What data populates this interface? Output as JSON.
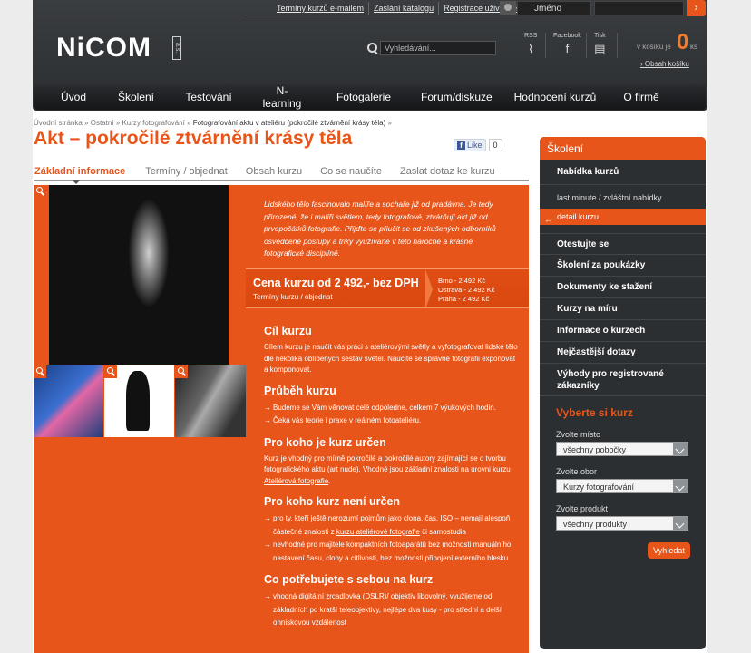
{
  "header": {
    "top_links": [
      "Termíny kurzů e-mailem",
      "Zaslání katalogu",
      "Registrace uživatele"
    ],
    "login_placeholder": "Jméno",
    "login_go": "›",
    "logo": "NiCOM",
    "logo_suffix": "a.s.",
    "search_placeholder": "Vyhledávání...",
    "social": [
      {
        "label": "RSS",
        "glyph": "⌇"
      },
      {
        "label": "Facebook",
        "glyph": "f"
      },
      {
        "label": "Tisk",
        "glyph": "▤"
      }
    ],
    "cart_label": "v košíku je",
    "cart_count": "0",
    "cart_unit": "ks",
    "cart_link": "Obsah košíku"
  },
  "nav": [
    "Úvod",
    "Školení",
    "Testování",
    "N-learning",
    "Fotogalerie",
    "Forum/diskuze",
    "Hodnocení kurzů",
    "O firmě"
  ],
  "breadcrumb": {
    "items": [
      "Úvodní stránka",
      "Ostatní",
      "Kurzy fotografování"
    ],
    "current": "Fotografování aktu v ateliéru (pokročilé ztvárnění krásy těla)"
  },
  "page_title": "Akt – pokročilé ztvárnění krásy těla",
  "fb": {
    "like": "Like",
    "count": "0"
  },
  "tabs": [
    "Základní informace",
    "Termíny / objednat",
    "Obsah kurzu",
    "Co se naučíte",
    "Zaslat dotaz ke kurzu"
  ],
  "intro": "Lidského tělo fascinovalo malíře a sochaře již od pradávna. Je tedy přirozené, že i malíři světlem, tedy fotografové, ztvárňují akt již od prvopočátků fotografie. Přijďte se přiučit se od zkušených odborníků osvědčené postupy a triky využívané v této náročné a krásné fotografické disciplíně.",
  "price": {
    "title": "Cena kurzu od 2 492,- bez DPH",
    "subtitle": "Termíny kurzu / objednat",
    "cities": [
      "Brno - 2 492 Kč",
      "Ostrava - 2 492 Kč",
      "Praha - 2 492 Kč"
    ]
  },
  "sections": {
    "cil_title": "Cíl kurzu",
    "cil_text": "Cílem kurzu je naučit vás práci s ateliérovými světly a vyfotografovat lidské tělo dle několika oblíbených sestav světel. Naučíte se správně fotografii exponovat a komponovat.",
    "prubeh_title": "Průběh kurzu",
    "prubeh_items": [
      "Budeme se Vám věnovat celé odpoledne, celkem 7 výukových hodin.",
      "Čeká vás teorie i praxe v reálném fotoateliéru."
    ],
    "pro_title": "Pro koho je kurz určen",
    "pro_text_a": "Kurz je vhodný pro mírně pokročilé a pokročilé autory zajímající se o tvorbu fotografického aktu (art nude).  Vhodné jsou základní znalosti na úrovni kurzu ",
    "pro_link": "Ateliérová fotografie",
    "pro_text_b": ".",
    "neni_title": "Pro koho kurz není určen",
    "neni_item1_a": "pro ty, kteří ještě nerozumí pojmům jako clona, čas, ISO – nemají alespoň částečné znalosti z ",
    "neni_item1_link": "kurzu ateliérové fotografie",
    "neni_item1_b": " či samostudia",
    "neni_item2": "nevhodné  pro majitele kompaktních fotoaparátů bez možnosti manuálního nastavení času, clony a citlivosti, bez možnosti připojení externího blesku",
    "sebou_title": "Co potřebujete s sebou na kurz",
    "sebou_item1": "vhodná digitální zrcadlovka (DSLR)/ objektiv libovolný, využijeme od základních po kratší teleobjektivy, nejlépe dva kusy - pro střední a delší ohniskovou vzdálenost"
  },
  "sidebar": {
    "head": "Školení",
    "items_top": [
      "Nabídka kurzů"
    ],
    "subs": [
      "last minute / zvláštní nabídky",
      "detail kurzu"
    ],
    "items": [
      "Otestujte se",
      "Školení za poukázky",
      "Dokumenty ke stažení",
      "Kurzy na míru",
      "Informace o kurzech",
      "Nejčastější dotazy",
      "Výhody pro registrované zákazníky"
    ],
    "pick_title": "Vyberte si kurz",
    "pick": [
      {
        "label": "Zvolte místo",
        "value": "všechny pobočky"
      },
      {
        "label": "Zvolte obor",
        "value": "Kurzy fotografování"
      },
      {
        "label": "Zvolte produkt",
        "value": "všechny produkty"
      }
    ],
    "pick_button": "Vyhledat"
  },
  "colors": {
    "accent": "#e8551a",
    "dark": "#2c2f32"
  }
}
